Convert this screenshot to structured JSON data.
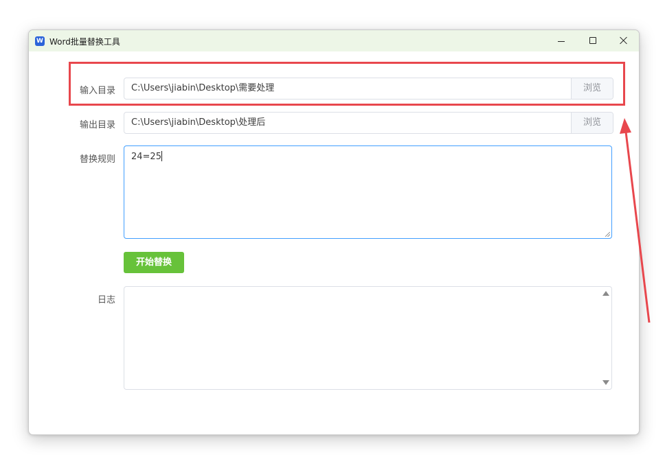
{
  "window": {
    "title": "Word批量替换工具",
    "app_icon_letter": "W",
    "icon": "word-app-icon"
  },
  "form": {
    "input_dir": {
      "label": "输入目录",
      "value": "C:\\Users\\jiabin\\Desktop\\需要处理",
      "browse_label": "浏览"
    },
    "output_dir": {
      "label": "输出目录",
      "value": "C:\\Users\\jiabin\\Desktop\\处理后",
      "browse_label": "浏览"
    },
    "rules": {
      "label": "替换规则",
      "value": "24=25"
    },
    "start_button": "开始替换",
    "log": {
      "label": "日志",
      "value": ""
    }
  },
  "colors": {
    "titlebar": "#edf6e7",
    "primary_button": "#67c23a",
    "focus_border": "#409eff",
    "annotation": "#e8474d"
  },
  "annotations": {
    "highlight": "red-rectangle-around-input-directory",
    "arrow": "red-arrow-pointing-up"
  }
}
